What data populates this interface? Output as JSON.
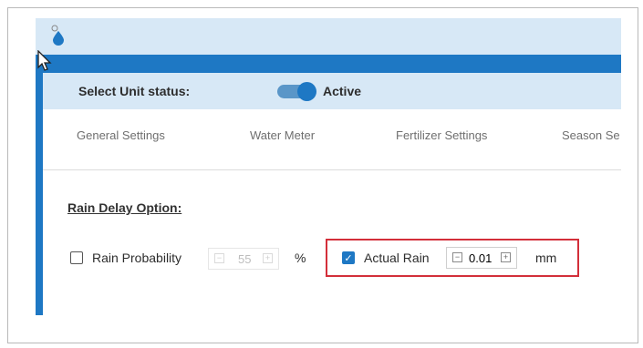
{
  "status_bar": {
    "label": "Select Unit status:",
    "toggle_on": true,
    "value": "Active"
  },
  "tabs": [
    "General Settings",
    "Water Meter",
    "Fertilizer Settings",
    "Season Se"
  ],
  "rain_delay": {
    "title": "Rain Delay Option:",
    "rain_probability": {
      "label": "Rain Probability",
      "checked": false,
      "value": "55",
      "unit": "%",
      "enabled": false
    },
    "actual_rain": {
      "label": "Actual Rain",
      "checked": true,
      "value": "0.01",
      "unit": "mm",
      "enabled": true,
      "highlighted": true
    }
  },
  "icons": {
    "app": "water-drop-icon",
    "cursor": "mouse-pointer-icon"
  },
  "colors": {
    "accent": "#1e78c4",
    "header_bg": "#d7e8f6",
    "highlight_border": "#d32f3a"
  }
}
